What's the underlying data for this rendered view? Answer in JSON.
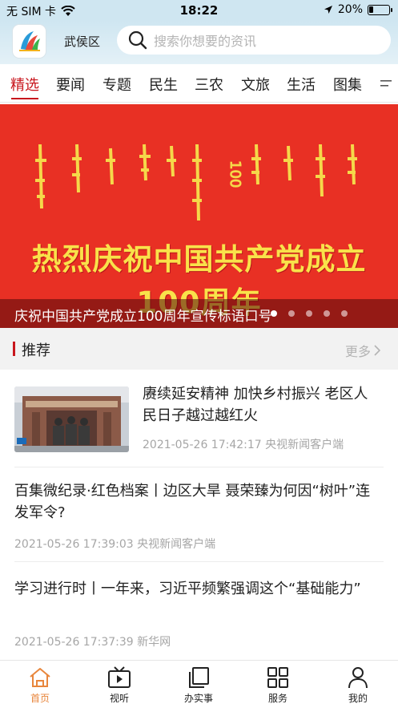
{
  "status_bar": {
    "carrier": "无 SIM 卡",
    "time": "18:22",
    "battery": "20%",
    "battery_level": 0.2
  },
  "header": {
    "district": "武侯区",
    "search_placeholder": "搜索你想要的资讯"
  },
  "tabs": [
    "精选",
    "要闻",
    "专题",
    "民生",
    "三农",
    "文旅",
    "生活",
    "图集"
  ],
  "active_tab": "精选",
  "banner": {
    "slogan": "热烈庆祝中国共产党成立100周年",
    "caption": "庆祝中国共产党成立100周年宣传标语口号",
    "dot_count": 5,
    "active_dot": 0
  },
  "recommend": {
    "title": "推荐",
    "more": "更多"
  },
  "news": [
    {
      "title": "赓续延安精神 加快乡村振兴 老区人民日子越过越红火",
      "meta": "2021-05-26 17:42:17 央视新闻客户端",
      "has_thumb": true
    },
    {
      "title": "百集微纪录·红色档案丨边区大旱 聂荣臻为何因“树叶”连发军令?",
      "meta": "2021-05-26 17:39:03 央视新闻客户端",
      "has_thumb": false
    },
    {
      "title": "学习进行时丨一年来，习近平频繁强调这个“基础能力”",
      "meta": "2021-05-26 17:37:39 新华网",
      "has_thumb": false
    }
  ],
  "bottom_nav": [
    {
      "label": "首页",
      "icon": "home-icon",
      "active": true
    },
    {
      "label": "视听",
      "icon": "video-icon",
      "active": false
    },
    {
      "label": "办实事",
      "icon": "documents-icon",
      "active": false
    },
    {
      "label": "服务",
      "icon": "grid-icon",
      "active": false
    },
    {
      "label": "我的",
      "icon": "user-icon",
      "active": false
    }
  ],
  "colors": {
    "accent_red": "#c8161d",
    "banner_red": "#e83024",
    "slogan_yellow": "#f9e24a",
    "nav_active": "#e8863c",
    "header_blue": "#cfe6f1"
  }
}
